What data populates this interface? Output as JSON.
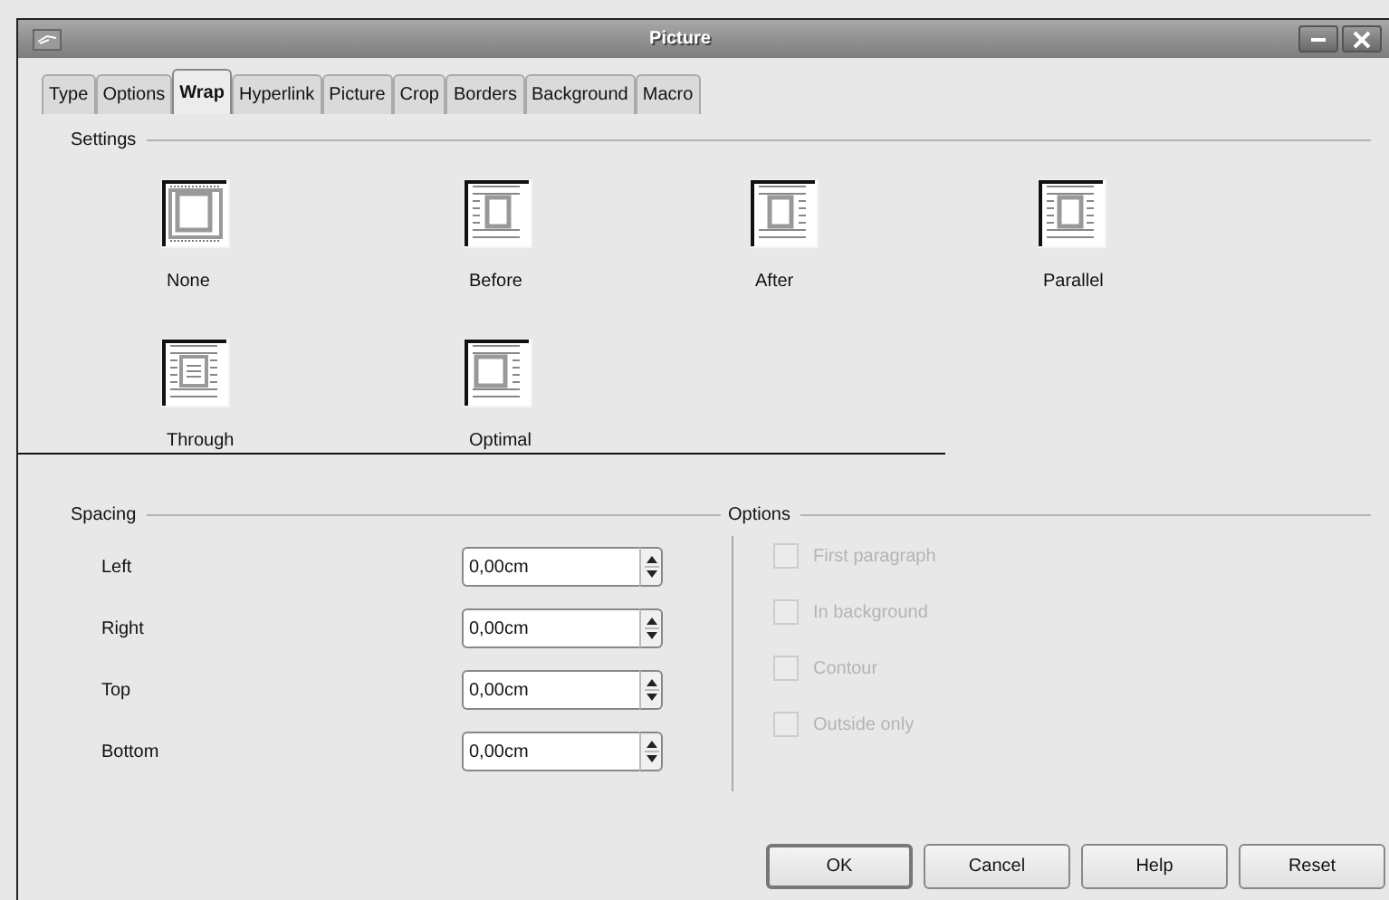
{
  "window": {
    "title": "Picture"
  },
  "tabs": [
    {
      "label": "Type",
      "selected": false
    },
    {
      "label": "Options",
      "selected": false
    },
    {
      "label": "Wrap",
      "selected": true
    },
    {
      "label": "Hyperlink",
      "selected": false
    },
    {
      "label": "Picture",
      "selected": false
    },
    {
      "label": "Crop",
      "selected": false
    },
    {
      "label": "Borders",
      "selected": false
    },
    {
      "label": "Background",
      "selected": false
    },
    {
      "label": "Macro",
      "selected": false
    }
  ],
  "settings": {
    "heading": "Settings",
    "options": [
      {
        "label": "None",
        "kind": "none"
      },
      {
        "label": "Before",
        "kind": "before"
      },
      {
        "label": "After",
        "kind": "after"
      },
      {
        "label": "Parallel",
        "kind": "parallel"
      },
      {
        "label": "Through",
        "kind": "through"
      },
      {
        "label": "Optimal",
        "kind": "optimal"
      }
    ]
  },
  "spacing": {
    "heading": "Spacing",
    "fields": [
      {
        "label": "Left",
        "value": "0,00cm"
      },
      {
        "label": "Right",
        "value": "0,00cm"
      },
      {
        "label": "Top",
        "value": "0,00cm"
      },
      {
        "label": "Bottom",
        "value": "0,00cm"
      }
    ]
  },
  "options": {
    "heading": "Options",
    "items": [
      {
        "label": "First paragraph",
        "checked": false,
        "disabled": true
      },
      {
        "label": "In background",
        "checked": false,
        "disabled": true
      },
      {
        "label": "Contour",
        "checked": false,
        "disabled": true
      },
      {
        "label": "Outside only",
        "checked": false,
        "disabled": true
      }
    ]
  },
  "buttons": [
    "OK",
    "Cancel",
    "Help",
    "Reset"
  ]
}
